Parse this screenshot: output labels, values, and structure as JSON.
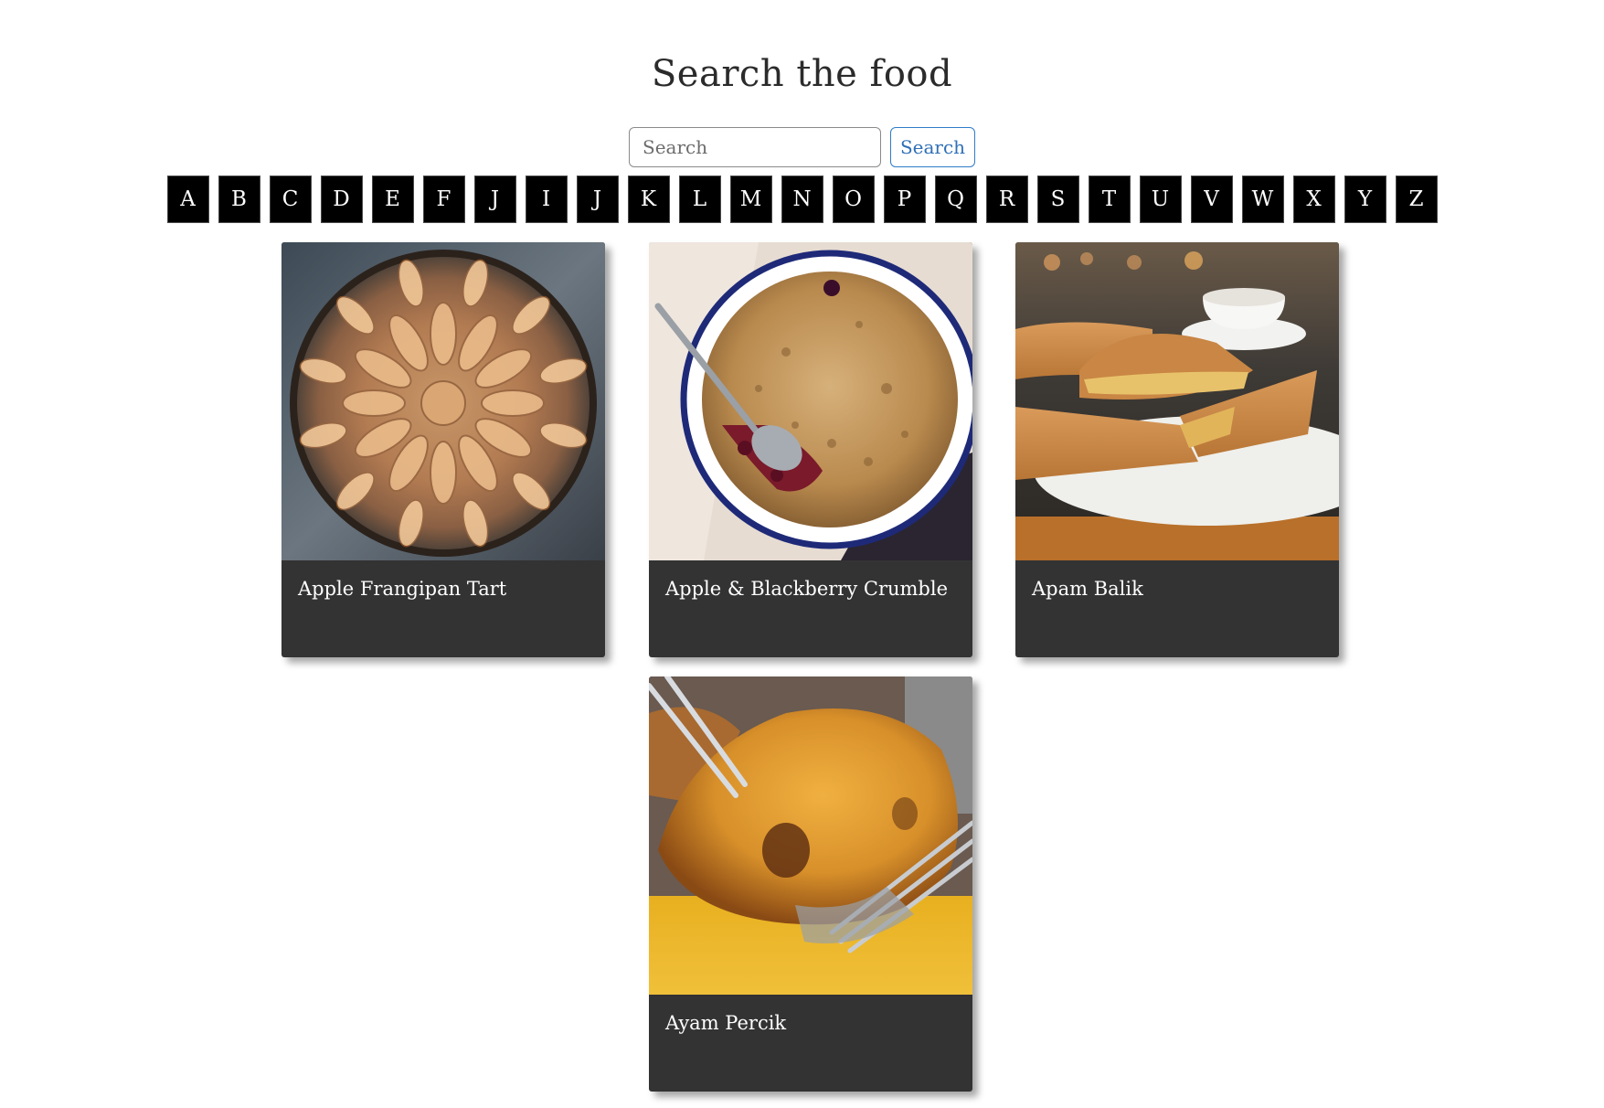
{
  "header": {
    "title": "Search the food"
  },
  "search": {
    "placeholder": "Search",
    "button_label": "Search"
  },
  "alphabet": [
    "A",
    "B",
    "C",
    "D",
    "E",
    "F",
    "J",
    "I",
    "J",
    "K",
    "L",
    "M",
    "N",
    "O",
    "P",
    "Q",
    "R",
    "S",
    "T",
    "U",
    "V",
    "W",
    "X",
    "Y",
    "Z"
  ],
  "meals": [
    {
      "name": "Apple Frangipan Tart",
      "photo": "apple-tart-photo"
    },
    {
      "name": "Apple & Blackberry Crumble",
      "photo": "crumble-photo"
    },
    {
      "name": "Apam Balik",
      "photo": "apam-balik-photo"
    },
    {
      "name": "Ayam Percik",
      "photo": "ayam-percik-photo"
    }
  ],
  "colors": {
    "card_background": "#333333",
    "letter_background": "#000000",
    "search_accent": "#2f7cc9"
  }
}
